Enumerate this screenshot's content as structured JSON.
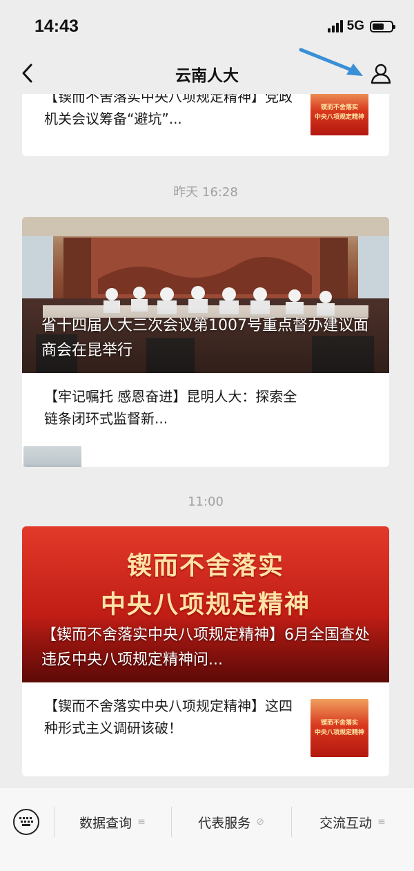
{
  "status": {
    "time": "14:43",
    "network": "5G",
    "battery_level": 0.6
  },
  "nav": {
    "title": "云南人大",
    "back_icon": "chevron-left-icon",
    "profile_icon": "person-icon"
  },
  "feed": {
    "top_item": {
      "title": "【锲而不舍落实中央八项规定精神】党政机关会议筹备“避坑”...",
      "thumb_line1": "锲而不舍落实",
      "thumb_line2": "中央八项规定精神"
    },
    "group1": {
      "time": "昨天 16:28",
      "hero_caption": "省十四届人大三次会议第1007号重点督办建议面商会在昆举行",
      "item": {
        "title": "【牢记嘱托 感恩奋进】昆明人大：探索全链条闭环式监督新..."
      }
    },
    "group2": {
      "time": "11:00",
      "hero_line1": "锲而不舍落实",
      "hero_line2": "中央八项规定精神",
      "hero_caption": "【锲而不舍落实中央八项规定精神】6月全国查处违反中央八项规定精神问...",
      "item": {
        "title": "【锲而不舍落实中央八项规定精神】这四种形式主义调研该破！",
        "thumb_line1": "锲而不舍落实",
        "thumb_line2": "中央八项规定精神"
      }
    }
  },
  "bottom_menu": {
    "keyboard_icon": "keyboard-icon",
    "items": [
      {
        "label": "数据查询",
        "glyph": "≡"
      },
      {
        "label": "代表服务",
        "glyph": "⊘"
      },
      {
        "label": "交流互动",
        "glyph": "≡"
      }
    ]
  },
  "colors": {
    "background": "#ededed",
    "card": "#ffffff",
    "accent_red": "#c21e16",
    "arrow_blue": "#3a8fd6"
  }
}
